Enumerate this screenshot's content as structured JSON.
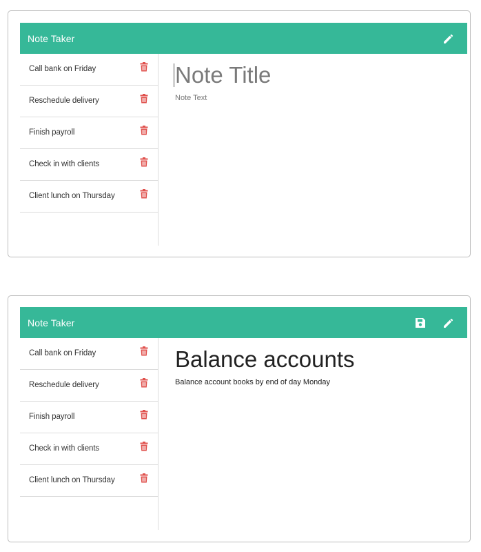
{
  "app": {
    "brand": "Note Taker"
  },
  "icons": {
    "new_note": "pencil-icon",
    "save_note": "floppy-disk-icon",
    "delete_note": "trash-icon"
  },
  "colors": {
    "navbar": "#36b898",
    "trash": "#e0524e"
  },
  "notes": [
    {
      "title": "Call bank on Friday"
    },
    {
      "title": "Reschedule delivery"
    },
    {
      "title": "Finish payroll"
    },
    {
      "title": "Check in with clients"
    },
    {
      "title": "Client lunch on Thursday"
    }
  ],
  "view_empty": {
    "title_placeholder": "Note Title",
    "text_placeholder": "Note Text"
  },
  "view_filled": {
    "title": "Balance accounts",
    "text": "Balance account books by end of day Monday"
  }
}
